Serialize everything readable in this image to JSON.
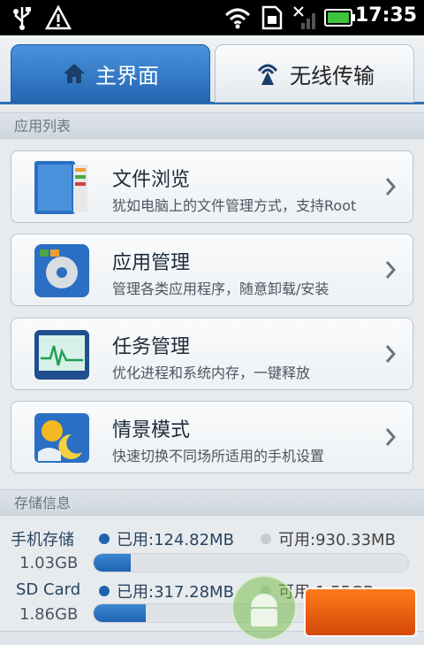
{
  "status_bar": {
    "time": "17:35",
    "icons": [
      "usb-icon",
      "warning-icon",
      "wifi-icon",
      "sim-icon",
      "no-signal-icon",
      "battery-icon"
    ]
  },
  "tabs": [
    {
      "label": "主界面",
      "icon": "home-icon",
      "active": true
    },
    {
      "label": "无线传输",
      "icon": "wireless-icon",
      "active": false
    }
  ],
  "apps_section": {
    "header": "应用列表"
  },
  "apps": [
    {
      "title": "文件浏览",
      "desc": "犹如电脑上的文件管理方式，支持Root",
      "icon": "file-browser-icon"
    },
    {
      "title": "应用管理",
      "desc": "管理各类应用程序，随意卸载/安装",
      "icon": "app-manager-icon"
    },
    {
      "title": "任务管理",
      "desc": "优化进程和系统内存，一键释放",
      "icon": "task-manager-icon"
    },
    {
      "title": "情景模式",
      "desc": "快速切换不同场所适用的手机设置",
      "icon": "scene-mode-icon"
    }
  ],
  "storage_section": {
    "header": "存储信息"
  },
  "storage": [
    {
      "label": "手机存储",
      "used": "已用:124.82MB",
      "free": "可用:930.33MB",
      "total": "1.03GB",
      "used_fraction": 0.118
    },
    {
      "label": "SD Card",
      "used": "已用:317.28MB",
      "free": "可用:1.55GB",
      "total": "1.86GB",
      "used_fraction": 0.166
    }
  ],
  "colors": {
    "accent": "#2366b2",
    "used_dot": "#1f63b0",
    "free_dot": "#c8ccd0"
  }
}
